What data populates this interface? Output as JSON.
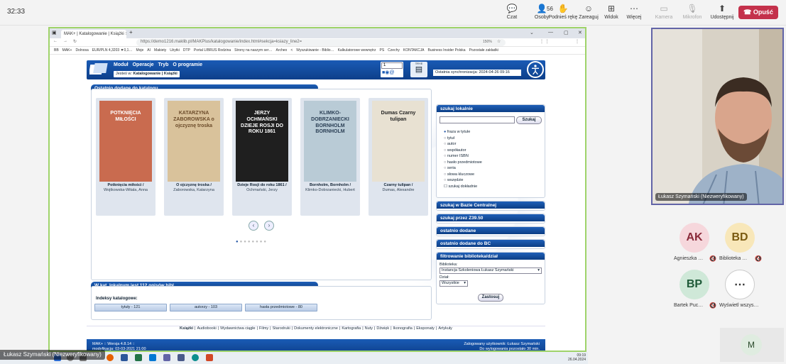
{
  "teams": {
    "timer": "32:33",
    "buttons": [
      {
        "label": "Czat",
        "icon": "chat-icon",
        "glyph": "💬"
      },
      {
        "label": "Osoby",
        "icon": "people-icon",
        "glyph": "👤",
        "badge": "56"
      },
      {
        "label": "Podnieś rękę",
        "icon": "raise-hand-icon",
        "glyph": "✋"
      },
      {
        "label": "Zareaguj",
        "icon": "react-icon",
        "glyph": "☺"
      },
      {
        "label": "Widok",
        "icon": "view-icon",
        "glyph": "⊞"
      },
      {
        "label": "Więcej",
        "icon": "more-icon",
        "glyph": "⋯"
      },
      {
        "label": "Kamera",
        "icon": "camera-off-icon",
        "glyph": "▭"
      },
      {
        "label": "Mikrofon",
        "icon": "mic-off-icon",
        "glyph": "🎙"
      },
      {
        "label": "Udostępnij",
        "icon": "share-icon",
        "glyph": "⬆"
      }
    ],
    "leave": "Opuść",
    "leave_color": "#c4314b"
  },
  "browser": {
    "tab_title": "MAK+ | Katalogowanie | Książki",
    "url": "https://demo1216.maklib.pl/MAKPlus/katalogowanie/index.html#sekcja=ksiazy_line2=",
    "zoom": "150%",
    "bookmarks": [
      "BB",
      "MAK+",
      "Dolnosa",
      "EUR/PLN 4,3203 ▼0,1…",
      "Moje",
      "AI",
      "Makiety",
      "Użytki",
      "DTP",
      "Portal LIBRUS Rodzina",
      "Strony na naszym ser…",
      "Archeo",
      "<",
      "Wyszukiwanie - Biblio…",
      "Kalkulatorowe wewnętrz",
      "PS",
      "Czechy",
      "KONTAKCJA",
      "Business Insider Polska",
      "Pozostałe zakładki"
    ]
  },
  "mak": {
    "menu": [
      "Moduł",
      "Operacje",
      "Tryb",
      "O programie"
    ],
    "jestes_prefix": "Jesteś w:",
    "jestes_path": "Katalogowanie | Książki",
    "login_value": "1",
    "trye": "TRYE",
    "sync": "Ostatnia synchronizacja: 2024-04-26 09:16",
    "recent_title": "Ostatnio dodane do katalogu",
    "books": [
      {
        "title": "Potknięcia miłości /",
        "author": "Wojtkowska-Witala, Anna",
        "cover_color": "#c96b4f",
        "cover_text": "POTKNIĘCIA MIŁOŚCI",
        "text_color": "#ffffff"
      },
      {
        "title": "O ojczyznę troska /",
        "author": "Zaborowska, Katarzyna",
        "cover_color": "#d9c29b",
        "cover_text": "KATARZYNA ZABOROWSKA o ojczyznę troska",
        "text_color": "#6b4b2a"
      },
      {
        "title": "Dzieje Rosji do roku 1861 /",
        "author": "Ochmański, Jerzy",
        "cover_color": "#1f1f1f",
        "cover_text": "JERZY OCHMAŃSKI DZIEJE ROSJI DO ROKU 1861",
        "text_color": "#ffffff"
      },
      {
        "title": "Bornholm, Bornholm /",
        "author": "Klimko-Dobrzaniecki, Hubert",
        "cover_color": "#b9cbd6",
        "cover_text": "KLIMKO-DOBRZANIECKI BORNHOLM BORNHOLM",
        "text_color": "#2b3f55"
      },
      {
        "title": "Czarny tulipan /",
        "author": "Dumas, Alexandre",
        "cover_color": "#e8e1d2",
        "cover_text": "Dumas Czarny tulipan",
        "text_color": "#222222"
      }
    ],
    "count_title": "W kat. lokalnym jest 112 opisów bibl.",
    "indexes_label": "Indeksy katalogowe:",
    "indexes": [
      "tytuły - 121",
      "autorzy - 103",
      "hasła przedmiotowe - 80"
    ],
    "search_title": "szukaj lokalnie",
    "search_button": "Szukaj",
    "search_value": "",
    "search_options": [
      "fraza w tytule",
      "tytuł",
      "autor",
      "współautor",
      "numer ISBN",
      "hasło przedmiotowe",
      "seria",
      "słowa kluczowe",
      "wszędzie"
    ],
    "search_selected": 0,
    "exact_search": "szukaj dokładnie",
    "collapsed_panels": [
      "szukaj w Bazie Centralnej",
      "szukaj przez Z39.50",
      "ostatnio dodane",
      "ostatnio dodane do BC"
    ],
    "filter_title": "filtrowanie biblioteka/dział",
    "library_label": "Biblioteka:",
    "library_value": "Instancja Szkoleniowa Łukasz Szymański",
    "dept_label": "Dział:",
    "dept_value": "Wszystkie",
    "apply": "Zastosuj",
    "links": [
      "Książki",
      "Audiobooki",
      "Wydawnictwa ciągłe",
      "Filmy",
      "Starodruki",
      "Dokumenty elektroniczne",
      "Kartografia",
      "Nuty",
      "Dźwięk",
      "Ikonografia",
      "Eksponaty",
      "Artykuły"
    ],
    "footer_left_1": "MAK+ :: Wersja 4.8.14 ::",
    "footer_left_2": "modyfikacja: 03-03-2021 21:00",
    "footer_right_1": "Zalogowany użytkownik: Łukasz Szymański",
    "footer_right_2": "Do wylogowania pozostało 30 min.",
    "primary_color": "#1a5bb5"
  },
  "taskbar": {
    "time": "09:19",
    "date": "26.04.2024",
    "presenter_tag": "Łukasz Szymański (Niezweryfikowany)"
  },
  "participants": {
    "camera_name": "Łukasz Szymański (Niezweryfikowany)",
    "avatars": [
      {
        "initials": "AK",
        "name": "Agnieszka …",
        "bg": "#f6d7dc",
        "fg": "#8a2a3a"
      },
      {
        "initials": "BD",
        "name": "Biblioteka …",
        "bg": "#f8e7b9",
        "fg": "#7a5a10"
      },
      {
        "initials": "BP",
        "name": "Bartek Puc…",
        "bg": "#cfe8d8",
        "fg": "#1f5a38"
      },
      {
        "initials": "⋯",
        "name": "Wyświetl wszys…",
        "bg": "#ffffff",
        "fg": "#333333"
      }
    ],
    "bottom_initial": "M"
  }
}
